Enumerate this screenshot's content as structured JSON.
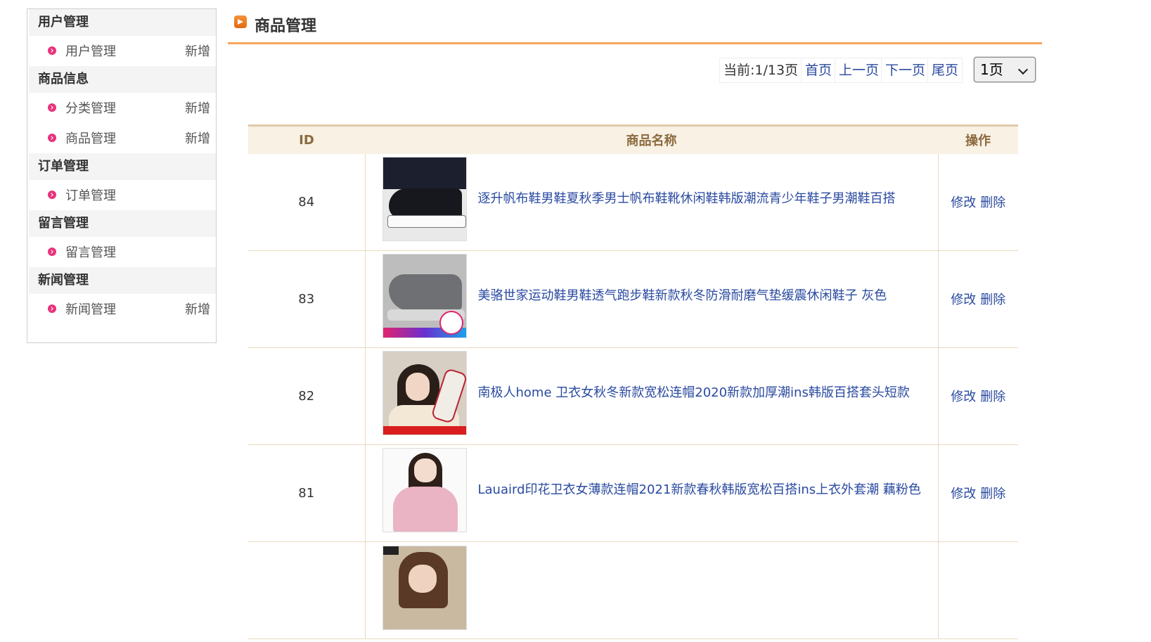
{
  "sidebar": {
    "groups": [
      {
        "title": "用户管理",
        "items": [
          {
            "label": "用户管理",
            "add": "新增"
          }
        ]
      },
      {
        "title": "商品信息",
        "items": [
          {
            "label": "分类管理",
            "add": "新增"
          },
          {
            "label": "商品管理",
            "add": "新增"
          }
        ]
      },
      {
        "title": "订单管理",
        "items": [
          {
            "label": "订单管理",
            "add": ""
          }
        ]
      },
      {
        "title": "留言管理",
        "items": [
          {
            "label": "留言管理",
            "add": ""
          }
        ]
      },
      {
        "title": "新闻管理",
        "items": [
          {
            "label": "新闻管理",
            "add": "新增"
          }
        ]
      }
    ]
  },
  "header": {
    "title": "商品管理",
    "icon": "orange-arrow-icon"
  },
  "pager": {
    "info": "当前:1/13页",
    "first": "首页",
    "prev": "上一页",
    "next": "下一页",
    "last": "尾页",
    "select_value": "1页"
  },
  "table": {
    "headers": {
      "id": "ID",
      "name": "商品名称",
      "op": "操作"
    },
    "rows": [
      {
        "id": "84",
        "name": "逐升帆布鞋男鞋夏秋季男士帆布鞋靴休闲鞋韩版潮流青少年鞋子男潮鞋百搭",
        "edit": "修改",
        "delete": "删除",
        "thumb": "black-canvas-sneaker"
      },
      {
        "id": "83",
        "name": "美骆世家运动鞋男鞋透气跑步鞋新款秋冬防滑耐磨气垫缓震休闲鞋子 灰色",
        "edit": "修改",
        "delete": "删除",
        "thumb": "grey-running-shoe"
      },
      {
        "id": "82",
        "name": "南极人home 卫衣女秋冬新款宽松连帽2020新款加厚潮ins韩版百搭套头短款",
        "edit": "修改",
        "delete": "删除",
        "thumb": "girl-beige-hoodie"
      },
      {
        "id": "81",
        "name": "Lauaird印花卫衣女薄款连帽2021新款春秋韩版宽松百搭ins上衣外套潮 藕粉色",
        "edit": "修改",
        "delete": "删除",
        "thumb": "girl-pink-hoodie"
      },
      {
        "id": "",
        "name": "",
        "edit": "",
        "delete": "",
        "thumb": "girl-brown-hoodie"
      }
    ]
  },
  "colors": {
    "accent": "#f6a55c",
    "link": "#2a4aa0",
    "bullet": "#e8327c",
    "table_header_bg": "#f8f1e4"
  }
}
